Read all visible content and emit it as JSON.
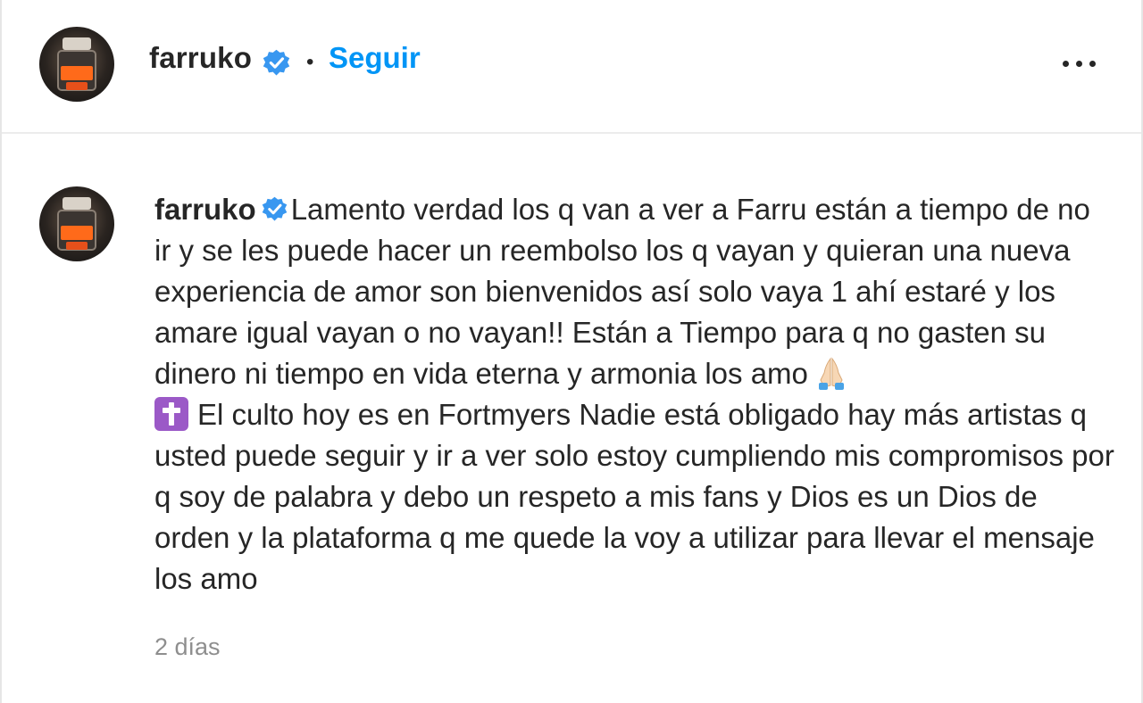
{
  "post_header": {
    "username": "farruko",
    "separator": "•",
    "follow_label": "Seguir",
    "avatar_icon": "profile-avatar",
    "verified_icon": "verified-badge-icon",
    "more_icon": "more-options-icon"
  },
  "comment": {
    "username": "farruko",
    "text_part1": "Lamento verdad los q van a ver a Farru están a tiempo de no ir y se les puede hacer un reembolso los q vayan y quieran una nueva experiencia de amor son bienvenidos así solo vaya 1 ahí estaré y los amare igual vayan o no vayan!! Están a Tiempo para q no gasten su dinero ni tiempo en vida eterna y armonia los amo",
    "emoji_1": "folded-hands-icon",
    "emoji_2": "latin-cross-icon",
    "text_part2": "El culto hoy es en Fortmyers Nadie está obligado hay más artistas q usted puede seguir y ir a ver solo estoy cumpliendo mis compromisos por q soy de palabra y debo un respeto a mis fans y Dios es un Dios de orden y la plataforma q me quede la voy a utilizar para llevar el mensaje los amo",
    "timestamp": "2 días"
  },
  "colors": {
    "accent_blue": "#0095f6",
    "verified_blue": "#3897f0",
    "text": "#262626",
    "muted": "#8e8e8e",
    "divider": "#ececec"
  }
}
